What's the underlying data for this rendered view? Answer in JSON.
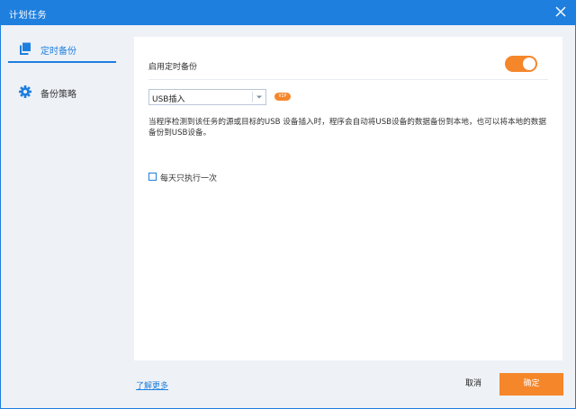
{
  "window": {
    "title": "计划任务",
    "close_icon": "close-icon",
    "accent": "#1e7fde"
  },
  "sidebar": {
    "items": [
      {
        "label": "定时备份",
        "icon": "copy-icon",
        "active": true
      },
      {
        "label": "备份策略",
        "icon": "gear-icon",
        "active": false
      }
    ]
  },
  "main": {
    "enable_label": "启用定时备份",
    "enable_toggle": {
      "on": true,
      "color": "#f5862a"
    },
    "trigger_select": {
      "value": "USB插入",
      "arrow_icon": "chevron-down-icon"
    },
    "badge": "VIP",
    "description": "当程序检测到该任务的源或目标的USB 设备插入时，程序会自动将USB设备的数据备份到本地，也可以将本地的数据备份到USB设备。",
    "once_daily": {
      "label": "每天只执行一次",
      "checked": false
    }
  },
  "footer": {
    "learn_more": "了解更多",
    "cancel": "取消",
    "ok": "确定",
    "ok_color": "#f5862a"
  }
}
